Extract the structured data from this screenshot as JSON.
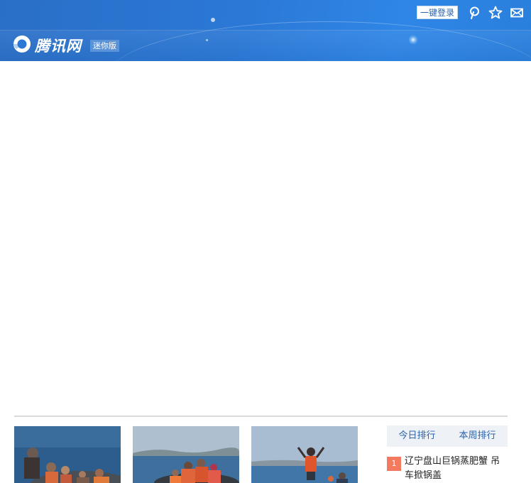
{
  "header": {
    "site_name": "腾讯网",
    "edition_tag": "迷你版",
    "login_label": "一键登录",
    "icons": [
      "pin-icon",
      "star-icon",
      "mail-icon"
    ]
  },
  "photos": [
    {
      "name": "news-photo-1"
    },
    {
      "name": "news-photo-2"
    },
    {
      "name": "news-photo-3"
    }
  ],
  "ranking": {
    "tabs": [
      {
        "label": "今日排行"
      },
      {
        "label": "本周排行"
      }
    ],
    "items": [
      {
        "rank": "1",
        "title": "辽宁盘山巨锅蒸肥蟹 吊车掀锅盖"
      }
    ]
  },
  "colors": {
    "header_blue": "#2b78d6",
    "link_blue": "#2d63a8",
    "rank_badge": "#f47a5f"
  }
}
